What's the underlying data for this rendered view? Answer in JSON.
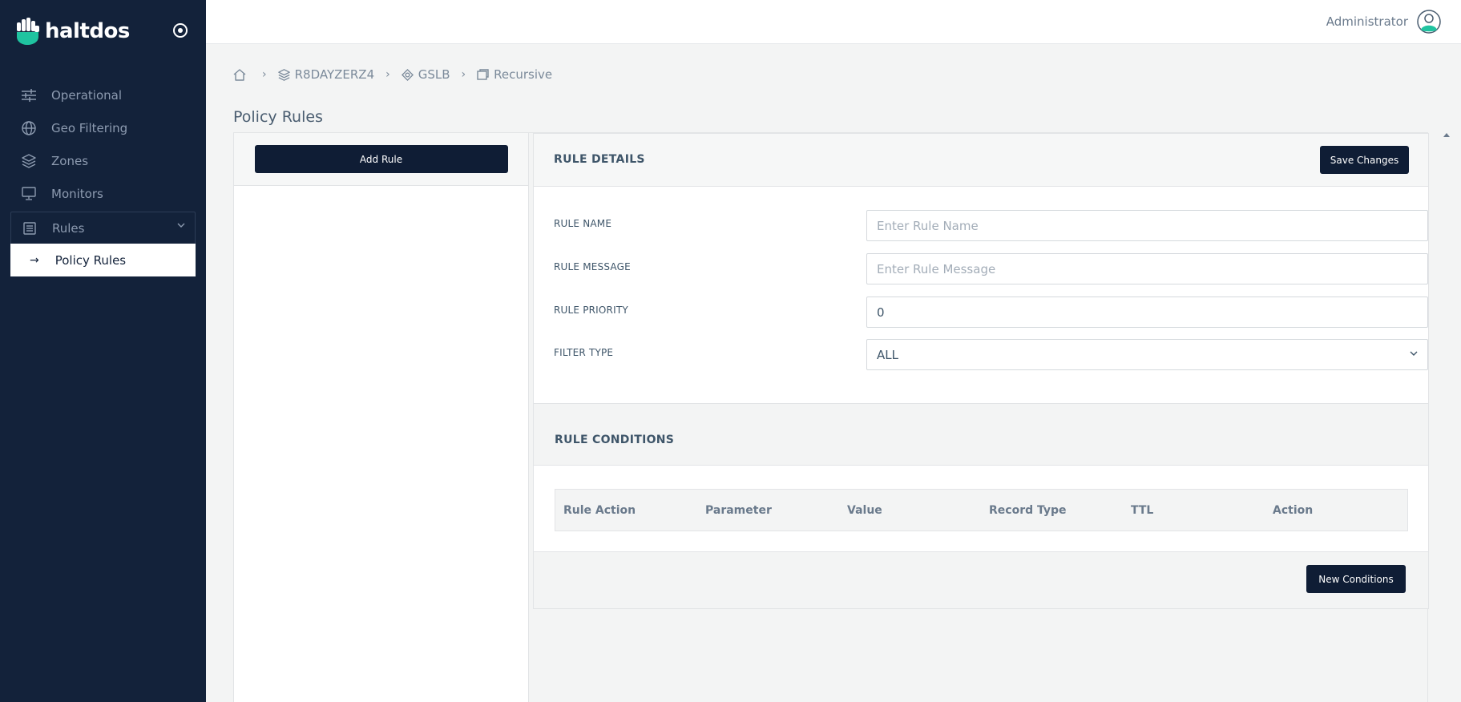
{
  "brand": {
    "name": "haltdos"
  },
  "sidebar": {
    "items": [
      {
        "label": "Operational",
        "icon": "sliders-icon"
      },
      {
        "label": "Geo Filtering",
        "icon": "globe-icon"
      },
      {
        "label": "Zones",
        "icon": "layers-icon"
      },
      {
        "label": "Monitors",
        "icon": "monitor-icon"
      },
      {
        "label": "Rules",
        "icon": "list-icon",
        "expanded": true
      }
    ],
    "subitems": [
      {
        "label": "Policy Rules",
        "active": true
      }
    ]
  },
  "header": {
    "user": "Administrator"
  },
  "breadcrumb": [
    {
      "label": "",
      "icon": "home-icon"
    },
    {
      "label": "R8DAYZERZ4",
      "icon": "layers-icon"
    },
    {
      "label": "GSLB",
      "icon": "target-icon"
    },
    {
      "label": "Recursive",
      "icon": "window-icon"
    }
  ],
  "page": {
    "title": "Policy Rules"
  },
  "left_panel": {
    "add_rule_label": "Add Rule"
  },
  "rule_details": {
    "title": "RULE DETAILS",
    "save_label": "Save Changes",
    "fields": {
      "name": {
        "label": "RULE NAME",
        "placeholder": "Enter Rule Name",
        "value": ""
      },
      "message": {
        "label": "RULE MESSAGE",
        "placeholder": "Enter Rule Message",
        "value": ""
      },
      "priority": {
        "label": "RULE PRIORITY",
        "value": "0"
      },
      "filter_type": {
        "label": "FILTER TYPE",
        "value": "ALL"
      }
    }
  },
  "rule_conditions": {
    "title": "RULE CONDITIONS",
    "columns": [
      "Rule Action",
      "Parameter",
      "Value",
      "Record Type",
      "TTL",
      "Action"
    ],
    "new_label": "New Conditions"
  },
  "colors": {
    "sidebar": "#13223a",
    "accent": "#1fc3a0",
    "button": "#0f1d35"
  }
}
